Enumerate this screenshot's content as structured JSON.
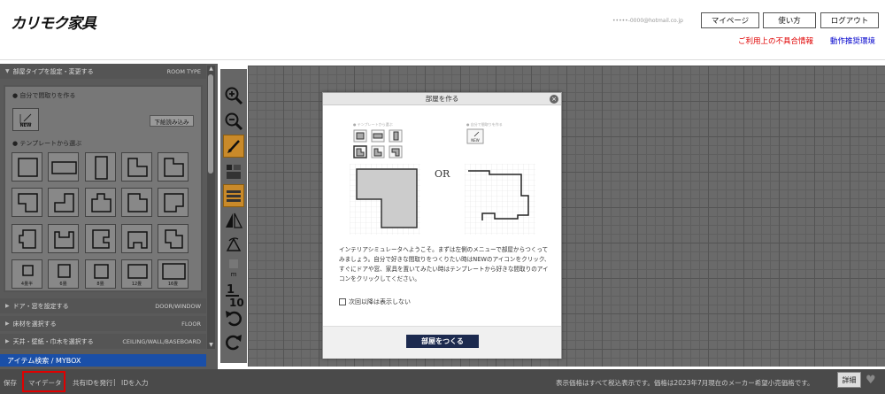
{
  "header": {
    "logo": "カリモク家具",
    "user_email": "•••••-0000@hotmail.co.jp",
    "buttons": {
      "mypage": "マイページ",
      "howto": "使い方",
      "logout": "ログアウト"
    },
    "links": {
      "bug_info": "ご利用上の不具合情報",
      "env": "動作推奨環境"
    },
    "colors": {
      "bug_info": "#e00000",
      "env": "#0000cc"
    }
  },
  "left_panel": {
    "room_type_label": "部屋タイプを設定・変更する",
    "room_type_tag": "ROOM TYPE",
    "self_make_label": "自分で間取りを作る",
    "new_label": "NEW",
    "download_label": "下絵読み込み",
    "template_label": "テンプレートから選ぶ",
    "size_tiles": [
      "4畳半",
      "6畳",
      "8畳",
      "12畳",
      "16畳"
    ],
    "door_label": "ドア・窓を設定する",
    "door_tag": "DOOR/WINDOW",
    "floor_label": "床材を選択する",
    "floor_tag": "FLOOR",
    "ceiling_label": "天井・壁紙・巾木を選択する",
    "ceiling_tag": "CEILING/WALL/BASEBOARD",
    "item_search": "アイテム検索 / MYBOX"
  },
  "tools": {
    "icons": [
      "zoom-in-icon",
      "zoom-out-icon",
      "pencil-icon",
      "layout-icon",
      "wall-icon",
      "flip-horizontal-icon",
      "rotate-triangle-icon",
      "unit-icon",
      "scale-icon",
      "undo-icon",
      "redo-icon"
    ],
    "scale_label": "1/10",
    "unit_label": "m"
  },
  "modal": {
    "title": "部屋を作る",
    "close": "×",
    "or": "OR",
    "template_caption": "テンプレートから選ぶ",
    "self_caption": "自分で間取りを作る",
    "new_label": "NEW",
    "description": "インテリアシミュレータへようこそ。まずは左側のメニューで部屋からつくってみましょう。自分で好きな間取りをつくりたい時はNEWのアイコンをクリック、すぐにドアや窓、家具を置いてみたい時はテンプレートから好きな間取りのアイコンをクリックしてください。",
    "checkbox_label": "次回以降は表示しない",
    "button_label": "部屋をつくる"
  },
  "bottom_bar": {
    "save": "保存",
    "mydata": "マイデータ",
    "share_id": "共有IDを発行",
    "separator": "|",
    "enter_id": "IDを入力",
    "price_note": "表示価格はすべて税込表示です。価格は2023年7月現在のメーカー希望小売価格です。",
    "detail": "詳細"
  }
}
